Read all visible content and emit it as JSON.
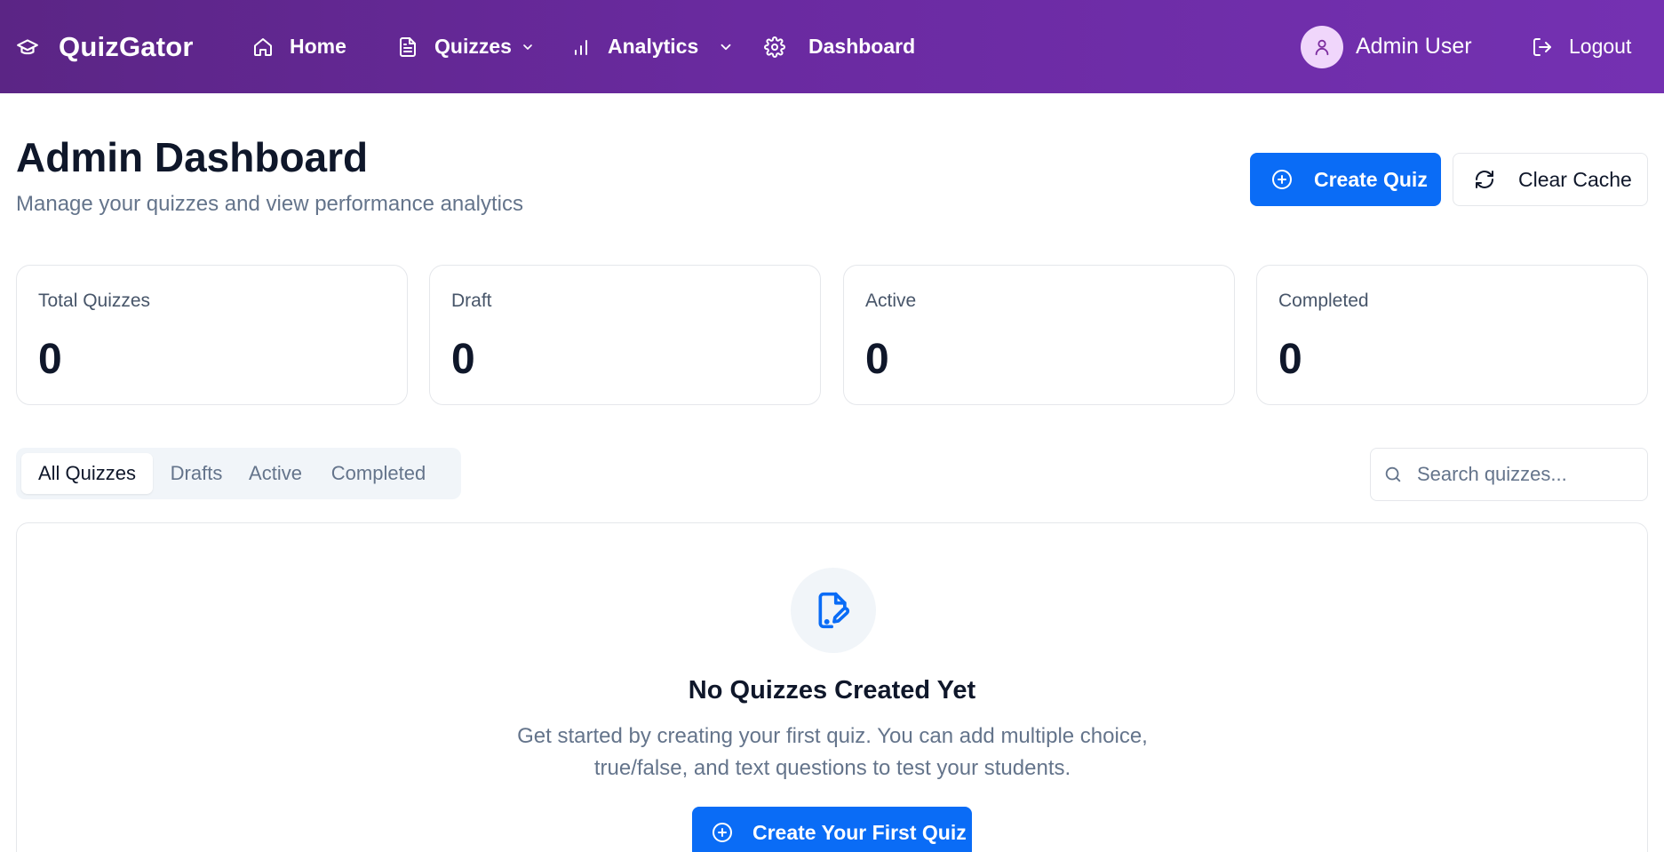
{
  "navbar": {
    "brand": "QuizGator",
    "links": {
      "home": "Home",
      "quizzes": "Quizzes",
      "analytics": "Analytics",
      "dashboard": "Dashboard"
    },
    "user_name": "Admin User",
    "logout": "Logout"
  },
  "header": {
    "title": "Admin Dashboard",
    "subtitle": "Manage your quizzes and view performance analytics",
    "create_quiz": "Create Quiz",
    "clear_cache": "Clear Cache"
  },
  "stats": [
    {
      "label": "Total Quizzes",
      "value": "0"
    },
    {
      "label": "Draft",
      "value": "0"
    },
    {
      "label": "Active",
      "value": "0"
    },
    {
      "label": "Completed",
      "value": "0"
    }
  ],
  "tabs": [
    {
      "label": "All Quizzes",
      "active": true
    },
    {
      "label": "Drafts",
      "active": false
    },
    {
      "label": "Active",
      "active": false
    },
    {
      "label": "Completed",
      "active": false
    }
  ],
  "search": {
    "placeholder": "Search quizzes...",
    "value": ""
  },
  "empty_state": {
    "title": "No Quizzes Created Yet",
    "description": "Get started by creating your first quiz. You can add multiple choice, true/false, and text questions to test your students.",
    "button": "Create Your First Quiz"
  },
  "colors": {
    "navbar_gradient_start": "#5b2585",
    "navbar_gradient_end": "#7431b2",
    "primary": "#0a6cf6",
    "avatar_bg": "#f0d6fb"
  },
  "icons": {
    "brand": "graduation-cap-icon",
    "home": "home-icon",
    "quizzes": "file-text-icon",
    "analytics": "bar-chart-icon",
    "dashboard": "gear-icon",
    "user": "user-icon",
    "logout": "logout-icon",
    "create": "plus-circle-icon",
    "clear_cache": "refresh-icon",
    "search": "search-icon",
    "empty": "file-edit-icon"
  }
}
